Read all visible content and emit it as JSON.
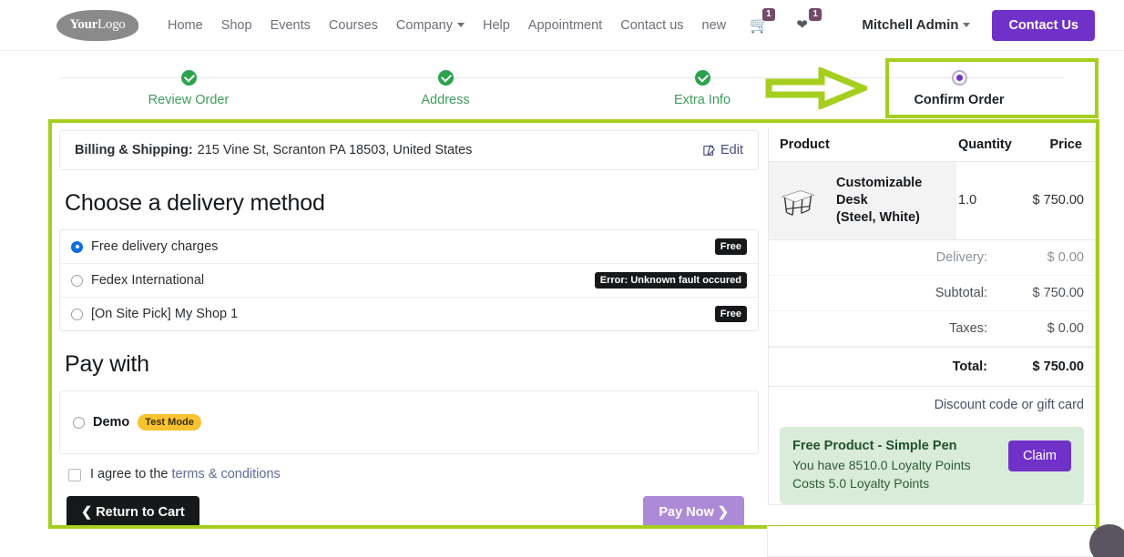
{
  "nav": {
    "logo_first": "Your",
    "logo_second": "Logo",
    "links": [
      {
        "label": "Home",
        "dropdown": false
      },
      {
        "label": "Shop",
        "dropdown": false
      },
      {
        "label": "Events",
        "dropdown": false
      },
      {
        "label": "Courses",
        "dropdown": false
      },
      {
        "label": "Company",
        "dropdown": true
      },
      {
        "label": "Help",
        "dropdown": false
      },
      {
        "label": "Appointment",
        "dropdown": false
      },
      {
        "label": "Contact us",
        "dropdown": false
      },
      {
        "label": "new",
        "dropdown": false
      }
    ],
    "cart_icon": "shopping-cart-icon",
    "cart_count": "1",
    "wishlist_icon": "heart-icon",
    "wishlist_count": "1",
    "user_name": "Mitchell Admin",
    "contact_button": "Contact Us",
    "accent_color": "#7031c9"
  },
  "wizard": {
    "steps": [
      {
        "label": "Review Order",
        "state": "done"
      },
      {
        "label": "Address",
        "state": "done"
      },
      {
        "label": "Extra Info",
        "state": "done"
      },
      {
        "label": "Confirm Order",
        "state": "current"
      }
    ],
    "done_color": "#2ba24c",
    "current_color": "#7031c9"
  },
  "annotations": {
    "highlight_color": "#a6ce1f",
    "arrow_icon": "right-arrow-annotation",
    "confirm_box": "confirm-order-highlight",
    "main_box": "checkout-content-highlight"
  },
  "billing": {
    "label": "Billing & Shipping:",
    "address": "215 Vine St, Scranton PA 18503, United States",
    "edit_label": "Edit",
    "edit_icon": "edit-pencil-icon"
  },
  "delivery": {
    "heading": "Choose a delivery method",
    "options": [
      {
        "label": "Free delivery charges",
        "tag": "Free",
        "selected": true
      },
      {
        "label": "Fedex International",
        "tag": "Error: Unknown fault occured",
        "selected": false
      },
      {
        "label": "[On Site Pick] My Shop 1",
        "tag": "Free",
        "selected": false
      }
    ]
  },
  "payment": {
    "heading": "Pay with",
    "methods": [
      {
        "name": "Demo",
        "badge": "Test Mode",
        "selected": false
      }
    ],
    "terms_prefix": "I agree to the ",
    "terms_link": "terms & conditions",
    "return_button": "Return to Cart",
    "pay_button": "Pay Now"
  },
  "summary": {
    "columns": {
      "product": "Product",
      "quantity": "Quantity",
      "price": "Price"
    },
    "items": [
      {
        "name_line1": "Customizable Desk",
        "name_line2": "(Steel, White)",
        "quantity": "1.0",
        "price": "$ 750.00",
        "thumb": "desk-product-image"
      }
    ],
    "lines": [
      {
        "label": "Delivery:",
        "value": "$ 0.00",
        "muted": true
      },
      {
        "label": "Subtotal:",
        "value": "$ 750.00",
        "muted": false
      },
      {
        "label": "Taxes:",
        "value": "$ 0.00",
        "muted": false
      }
    ],
    "total_label": "Total:",
    "total_value": "$ 750.00",
    "discount_link": "Discount code or gift card"
  },
  "reward": {
    "title": "Free Product - Simple Pen",
    "points_have": "You have 8510.0 Loyalty Points",
    "points_cost": "Costs 5.0 Loyalty Points",
    "claim_button": "Claim",
    "bg_color": "#d9ecd9"
  }
}
